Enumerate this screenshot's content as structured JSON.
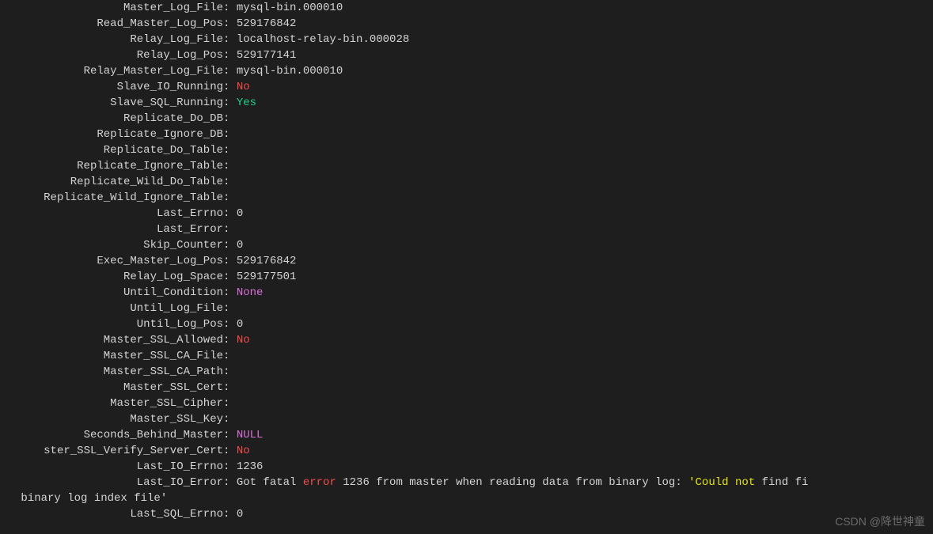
{
  "rows": [
    {
      "label": "Master_Log_File",
      "value": "mysql-bin.000010",
      "cls": ""
    },
    {
      "label": "Read_Master_Log_Pos",
      "value": "529176842",
      "cls": ""
    },
    {
      "label": "Relay_Log_File",
      "value": "localhost-relay-bin.000028",
      "cls": ""
    },
    {
      "label": "Relay_Log_Pos",
      "value": "529177141",
      "cls": ""
    },
    {
      "label": "Relay_Master_Log_File",
      "value": "mysql-bin.000010",
      "cls": ""
    },
    {
      "label": "Slave_IO_Running",
      "value": "No",
      "cls": "red"
    },
    {
      "label": "Slave_SQL_Running",
      "value": "Yes",
      "cls": "green"
    },
    {
      "label": "Replicate_Do_DB",
      "value": "",
      "cls": ""
    },
    {
      "label": "Replicate_Ignore_DB",
      "value": "",
      "cls": ""
    },
    {
      "label": "Replicate_Do_Table",
      "value": "",
      "cls": ""
    },
    {
      "label": "Replicate_Ignore_Table",
      "value": "",
      "cls": ""
    },
    {
      "label": "Replicate_Wild_Do_Table",
      "value": "",
      "cls": ""
    },
    {
      "label": "Replicate_Wild_Ignore_Table",
      "value": "",
      "cls": ""
    },
    {
      "label": "Last_Errno",
      "value": "0",
      "cls": ""
    },
    {
      "label": "Last_Error",
      "value": "",
      "cls": ""
    },
    {
      "label": "Skip_Counter",
      "value": "0",
      "cls": ""
    },
    {
      "label": "Exec_Master_Log_Pos",
      "value": "529176842",
      "cls": ""
    },
    {
      "label": "Relay_Log_Space",
      "value": "529177501",
      "cls": ""
    },
    {
      "label": "Until_Condition",
      "value": "None",
      "cls": "magenta"
    },
    {
      "label": "Until_Log_File",
      "value": "",
      "cls": ""
    },
    {
      "label": "Until_Log_Pos",
      "value": "0",
      "cls": ""
    },
    {
      "label": "Master_SSL_Allowed",
      "value": "No",
      "cls": "red"
    },
    {
      "label": "Master_SSL_CA_File",
      "value": "",
      "cls": ""
    },
    {
      "label": "Master_SSL_CA_Path",
      "value": "",
      "cls": ""
    },
    {
      "label": "Master_SSL_Cert",
      "value": "",
      "cls": ""
    },
    {
      "label": "Master_SSL_Cipher",
      "value": "",
      "cls": ""
    },
    {
      "label": "Master_SSL_Key",
      "value": "",
      "cls": ""
    },
    {
      "label": "Seconds_Behind_Master",
      "value": "NULL",
      "cls": "magenta"
    },
    {
      "label": "ster_SSL_Verify_Server_Cert",
      "value": "No",
      "cls": "red",
      "truncated": true
    },
    {
      "label": "Last_IO_Errno",
      "value": "1236",
      "cls": ""
    }
  ],
  "io_error": {
    "label": "Last_IO_Error",
    "pre": "Got fatal ",
    "err_word": "error",
    "mid": " 1236 from master when reading data from binary log: ",
    "quote1": "'",
    "could_not": "Could not",
    "tail": " find fi",
    "wrap": " binary log index file'"
  },
  "last_sql": {
    "label": "Last_SQL_Errno",
    "value": "0"
  },
  "watermark": "CSDN @降世神童"
}
